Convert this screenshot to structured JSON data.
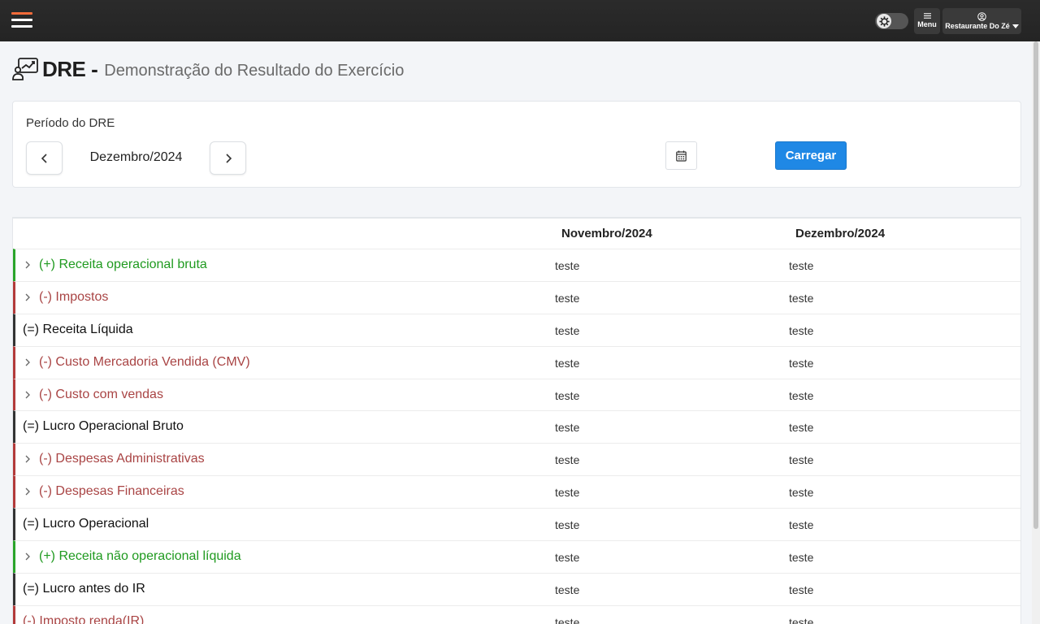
{
  "topbar": {
    "menu_label": "Menu",
    "user_label": "Restaurante Do Zé",
    "theme_icon": "gear-icon"
  },
  "header": {
    "title": "DRE -",
    "subtitle": "Demonstração do Resultado do Exercício"
  },
  "period": {
    "label": "Período do DRE",
    "value": "Dezembro/2024",
    "load_label": "Carregar"
  },
  "table": {
    "columns": [
      "Novembro/2024",
      "Dezembro/2024"
    ],
    "rows": [
      {
        "label": "(+) Receita operacional bruta",
        "kind": "pos",
        "values": [
          "teste",
          "teste"
        ]
      },
      {
        "label": "(-) Impostos",
        "kind": "neg",
        "values": [
          "teste",
          "teste"
        ]
      },
      {
        "label": "(=) Receita Líquida",
        "kind": "res",
        "values": [
          "teste",
          "teste"
        ]
      },
      {
        "label": "(-) Custo Mercadoria Vendida (CMV)",
        "kind": "neg",
        "values": [
          "teste",
          "teste"
        ]
      },
      {
        "label": "(-) Custo com vendas",
        "kind": "neg",
        "values": [
          "teste",
          "teste"
        ]
      },
      {
        "label": "(=) Lucro Operacional Bruto",
        "kind": "res",
        "values": [
          "teste",
          "teste"
        ]
      },
      {
        "label": "(-) Despesas Administrativas",
        "kind": "neg",
        "values": [
          "teste",
          "teste"
        ]
      },
      {
        "label": "(-) Despesas Financeiras",
        "kind": "neg",
        "values": [
          "teste",
          "teste"
        ]
      },
      {
        "label": "(=) Lucro Operacional",
        "kind": "res",
        "values": [
          "teste",
          "teste"
        ]
      },
      {
        "label": "(+) Receita não operacional líquida",
        "kind": "pos",
        "values": [
          "teste",
          "teste"
        ]
      },
      {
        "label": "(=) Lucro antes do IR",
        "kind": "res",
        "values": [
          "teste",
          "teste"
        ]
      },
      {
        "label": "(-) Imposto renda(IR)",
        "kind": "neg",
        "values": [
          "teste",
          "teste"
        ]
      }
    ]
  },
  "colors": {
    "positive": "#1f9a1f",
    "negative": "#a94444",
    "accent": "#1f88e5"
  }
}
